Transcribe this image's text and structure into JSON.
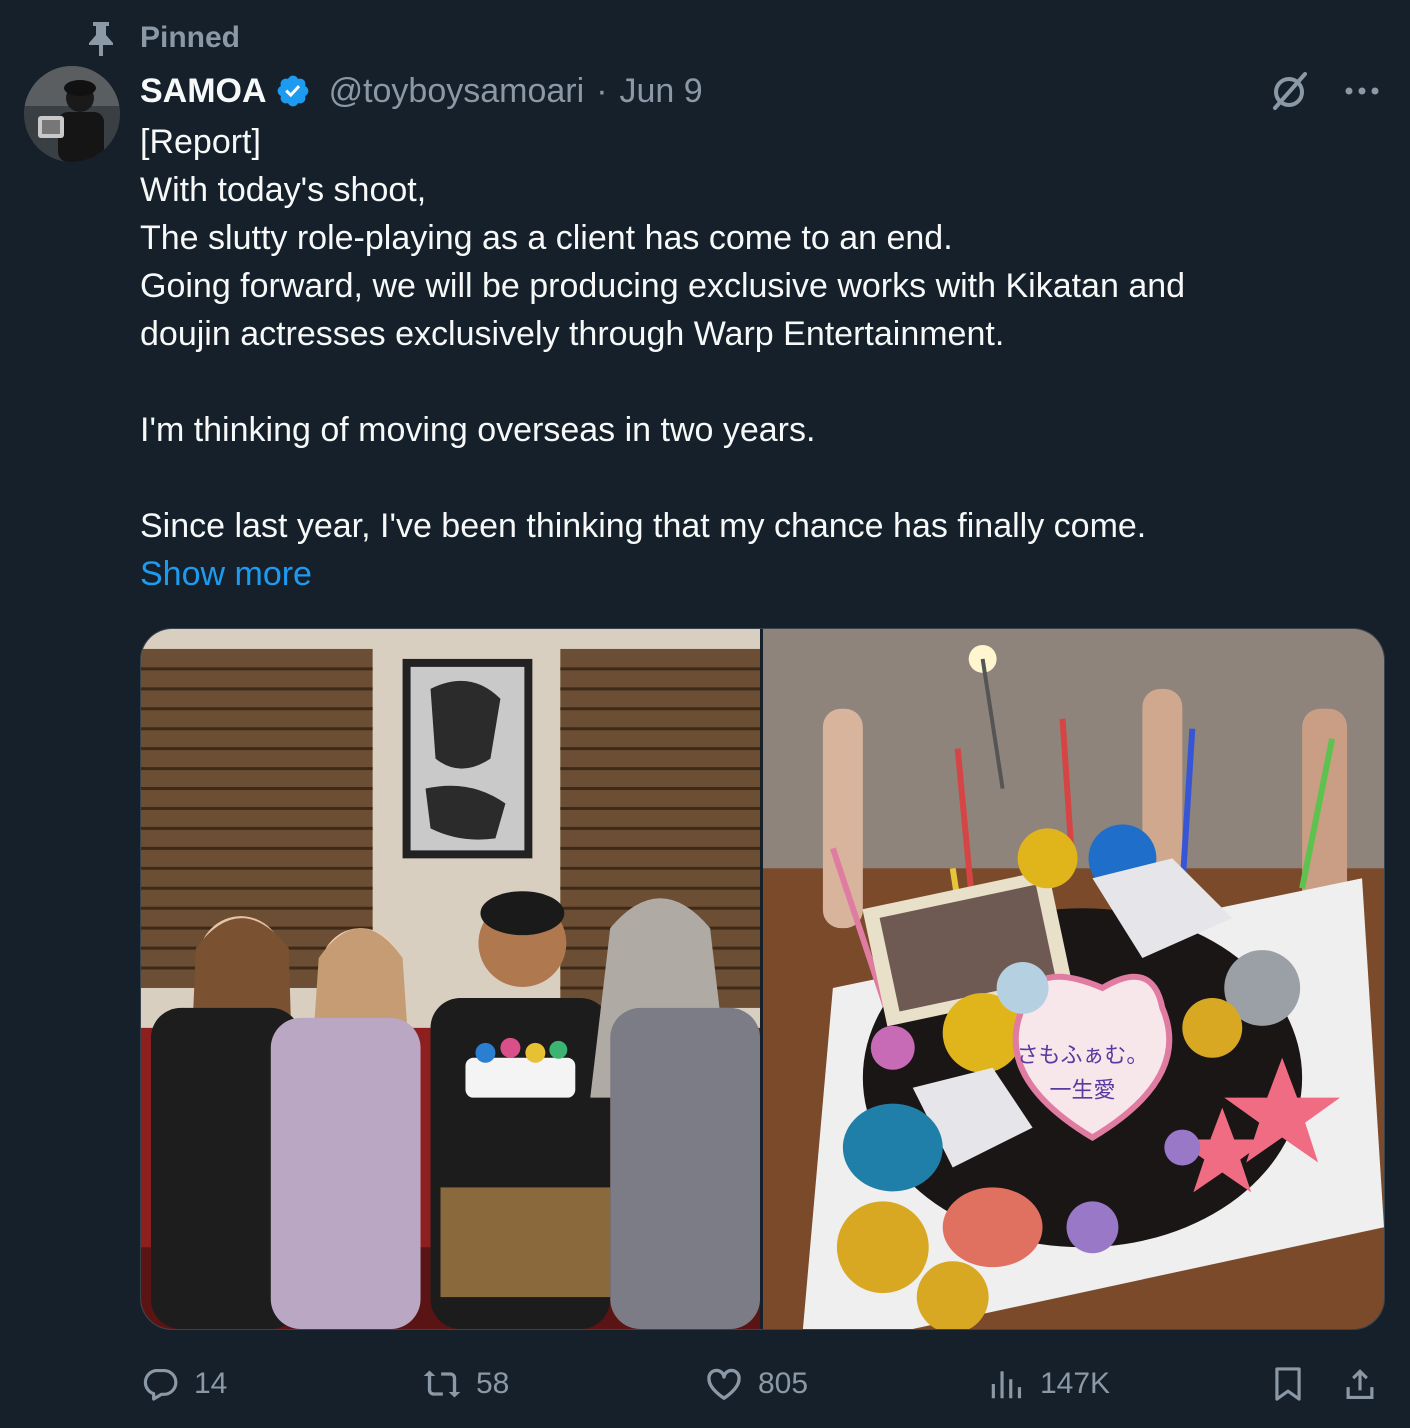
{
  "pinned": {
    "label": "Pinned",
    "icon": "pin-icon"
  },
  "author": {
    "display_name": "SAMOA",
    "handle": "@toyboysamoari",
    "separator": "·",
    "date": "Jun 9",
    "verified_color": "#1d9bf0"
  },
  "body": {
    "lines": [
      "[Report]",
      "With today's shoot,",
      "The slutty role-playing as a client has come to an end.",
      "Going forward, we will be producing exclusive works with Kikatan and",
      "doujin actresses exclusively through Warp Entertainment.",
      "",
      "I'm thinking of moving overseas in two years.",
      "",
      "Since last year, I've been thinking that my chance has finally come."
    ],
    "show_more": "Show more"
  },
  "media": {
    "photo_1": "group-photo",
    "photo_2": "cake-photo",
    "cake_text_1": "さもふぁむ。",
    "cake_text_2": "一生愛"
  },
  "stats": {
    "replies": "14",
    "reposts": "58",
    "likes": "805",
    "views": "147K"
  },
  "colors": {
    "background": "#15202b",
    "text": "#f7f9f9",
    "muted": "#8b98a5",
    "accent": "#1d9bf0"
  }
}
